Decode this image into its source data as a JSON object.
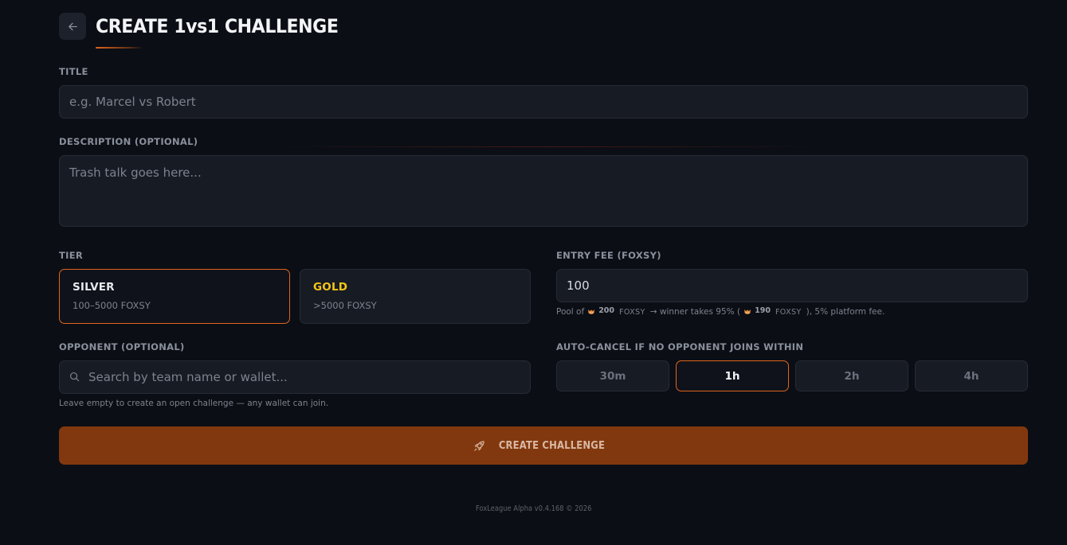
{
  "header": {
    "title": "CREATE 1vs1 CHALLENGE",
    "back_icon": "arrow-left-icon"
  },
  "form": {
    "title": {
      "label": "TITLE",
      "value": "",
      "placeholder": "e.g. Marcel vs Robert"
    },
    "description": {
      "label": "DESCRIPTION (OPTIONAL)",
      "value": "",
      "placeholder": "Trash talk goes here..."
    },
    "tier": {
      "label": "TIER",
      "selected": "SILVER",
      "options": [
        {
          "name": "SILVER",
          "range": "100–5000 FOXSY",
          "color": "#e6e8ec"
        },
        {
          "name": "GOLD",
          "range": ">5000 FOXSY",
          "color": "#f5c518"
        }
      ]
    },
    "entry_fee": {
      "label": "ENTRY FEE (FOXSY)",
      "value": "100",
      "pool_prefix": "Pool of",
      "pool_amount": "200",
      "unit": "FOXSY",
      "pool_middle": "→ winner takes 95% (",
      "winner_amount": "190",
      "pool_suffix": "), 5% platform fee."
    },
    "opponent": {
      "label": "OPPONENT (OPTIONAL)",
      "value": "",
      "placeholder": "Search by team name or wallet...",
      "hint": "Leave empty to create an open challenge — any wallet can join."
    },
    "auto_cancel": {
      "label": "AUTO-CANCEL IF NO OPPONENT JOINS WITHIN",
      "selected": "1h",
      "options": [
        "30m",
        "1h",
        "2h",
        "4h"
      ]
    },
    "submit_label": "CREATE CHALLENGE",
    "submit_icon": "rocket-icon"
  },
  "footer": {
    "text": "FoxLeague Alpha v0.4.168 © 2026"
  },
  "colors": {
    "background": "#0b0e15",
    "accent": "#e0651c",
    "button": "#82380e",
    "gold": "#f5c518"
  }
}
